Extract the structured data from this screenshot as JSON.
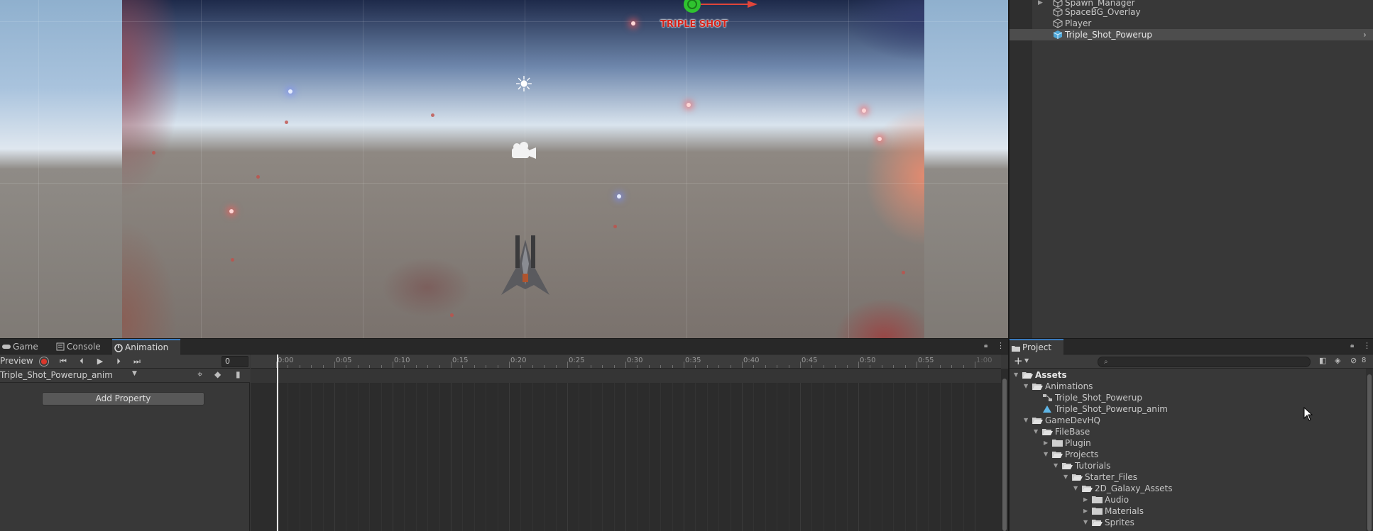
{
  "hierarchy": {
    "items": [
      {
        "label": "Spawn_Manager",
        "expandable": true,
        "selected": false
      },
      {
        "label": "SpaceBG_Overlay",
        "expandable": false,
        "selected": false
      },
      {
        "label": "Player",
        "expandable": false,
        "selected": false
      },
      {
        "label": "Triple_Shot_Powerup",
        "expandable": false,
        "selected": true
      }
    ]
  },
  "scene": {
    "powerup_text": "TRIPLE SHOT",
    "gizmos": [
      "directional-light-icon",
      "camera-icon",
      "move-tool-icon"
    ]
  },
  "tabs": {
    "game": "Game",
    "console": "Console",
    "animation": "Animation",
    "project": "Project"
  },
  "animation": {
    "preview_label": "Preview",
    "frame_value": "0",
    "clip_name": "Triple_Shot_Powerup_anim",
    "add_property_label": "Add Property",
    "ticks": [
      "0:00",
      "0:05",
      "0:10",
      "0:15",
      "0:20",
      "0:25",
      "0:30",
      "0:35",
      "0:40",
      "0:45",
      "0:50",
      "0:55",
      "1:00"
    ]
  },
  "project": {
    "search_placeholder": "",
    "hidden_count": "8",
    "tree": [
      {
        "label": "Assets",
        "level": 0,
        "expanded": true,
        "type": "folder",
        "bold": true
      },
      {
        "label": "Animations",
        "level": 1,
        "expanded": true,
        "type": "folder"
      },
      {
        "label": "Triple_Shot_Powerup",
        "level": 2,
        "type": "animator-controller"
      },
      {
        "label": "Triple_Shot_Powerup_anim",
        "level": 2,
        "type": "animation-clip"
      },
      {
        "label": "GameDevHQ",
        "level": 1,
        "expanded": true,
        "type": "folder"
      },
      {
        "label": "FileBase",
        "level": 2,
        "expanded": true,
        "type": "folder"
      },
      {
        "label": "Plugin",
        "level": 3,
        "expanded": false,
        "type": "folder"
      },
      {
        "label": "Projects",
        "level": 3,
        "expanded": true,
        "type": "folder"
      },
      {
        "label": "Tutorials",
        "level": 4,
        "expanded": true,
        "type": "folder"
      },
      {
        "label": "Starter_Files",
        "level": 5,
        "expanded": true,
        "type": "folder"
      },
      {
        "label": "2D_Galaxy_Assets",
        "level": 6,
        "expanded": true,
        "type": "folder"
      },
      {
        "label": "Audio",
        "level": 7,
        "expanded": false,
        "type": "folder"
      },
      {
        "label": "Materials",
        "level": 7,
        "expanded": false,
        "type": "folder"
      },
      {
        "label": "Sprites",
        "level": 7,
        "expanded": true,
        "type": "folder"
      }
    ]
  },
  "colors": {
    "selection": "#4d4d4d",
    "accent": "#3a79bb",
    "record": "#d9372b",
    "powerup_text": "#d4231a"
  }
}
